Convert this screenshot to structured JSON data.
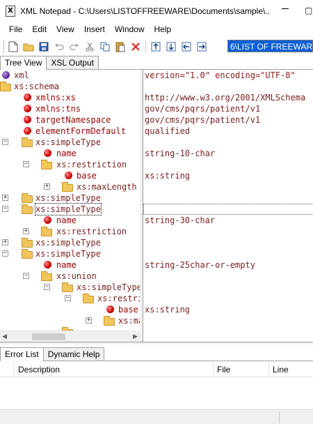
{
  "window": {
    "title": "XML Notepad - C:\\Users\\LISTOFFREEWARE\\Documents\\sample\\...",
    "app_icon_glyph": "X",
    "restore_glyph": "▢"
  },
  "menu": [
    "File",
    "Edit",
    "View",
    "Insert",
    "Window",
    "Help"
  ],
  "toolbar": {
    "icons": [
      "new-file-icon",
      "open-folder-icon",
      "save-icon",
      "undo-icon",
      "redo-icon",
      "cut-icon",
      "copy-icon",
      "paste-icon",
      "delete-icon",
      "nudge-up-icon",
      "nudge-down-icon",
      "nudge-left-icon",
      "nudge-right-icon"
    ],
    "location_value": "6\\LIST OF FREEWAR"
  },
  "tabs": {
    "tree_view": "Tree View",
    "xsl_output": "XSL Output"
  },
  "tree": [
    {
      "label": "xml",
      "kind": "pi",
      "value": "version=\"1.0\" encoding=\"UTF-8\""
    },
    {
      "label": "xs:schema",
      "kind": "element",
      "value": ""
    },
    {
      "label": "xmlns:xs",
      "kind": "attr",
      "value": "http://www.w3.org/2001/XMLSchema"
    },
    {
      "label": "xmlns:tns",
      "kind": "attr",
      "value": "gov/cms/pqrs/patient/v1"
    },
    {
      "label": "targetNamespace",
      "kind": "attr",
      "value": "gov/cms/pqrs/patient/v1"
    },
    {
      "label": "elementFormDefault",
      "kind": "attr",
      "value": "qualified"
    },
    {
      "label": "xs:simpleType",
      "kind": "element",
      "value": ""
    },
    {
      "label": "name",
      "kind": "attr",
      "value": "string-10-char"
    },
    {
      "label": "xs:restriction",
      "kind": "element",
      "value": ""
    },
    {
      "label": "base",
      "kind": "attr",
      "value": "xs:string"
    },
    {
      "label": "xs:maxLength",
      "kind": "element",
      "value": ""
    },
    {
      "label": "xs:simpleType",
      "kind": "element",
      "value": ""
    },
    {
      "label": "xs:simpleType",
      "kind": "element",
      "value": ""
    },
    {
      "label": "name",
      "kind": "attr",
      "value": "string-30-char"
    },
    {
      "label": "xs:restriction",
      "kind": "element",
      "value": ""
    },
    {
      "label": "xs:simpleType",
      "kind": "element",
      "value": ""
    },
    {
      "label": "xs:simpleType",
      "kind": "element",
      "value": ""
    },
    {
      "label": "name",
      "kind": "attr",
      "value": "string-25char-or-empty"
    },
    {
      "label": "xs:union",
      "kind": "element",
      "value": ""
    },
    {
      "label": "xs:simpleType",
      "kind": "element",
      "value": ""
    },
    {
      "label": "xs:restriction",
      "kind": "element",
      "value": ""
    },
    {
      "label": "base",
      "kind": "attr",
      "value": "xs:string"
    },
    {
      "label": "xs:maxLength",
      "kind": "element",
      "value": ""
    }
  ],
  "bottom_tabs": {
    "error_list": "Error List",
    "dynamic_help": "Dynamic Help"
  },
  "error_columns": [
    "Description",
    "File",
    "Line"
  ]
}
